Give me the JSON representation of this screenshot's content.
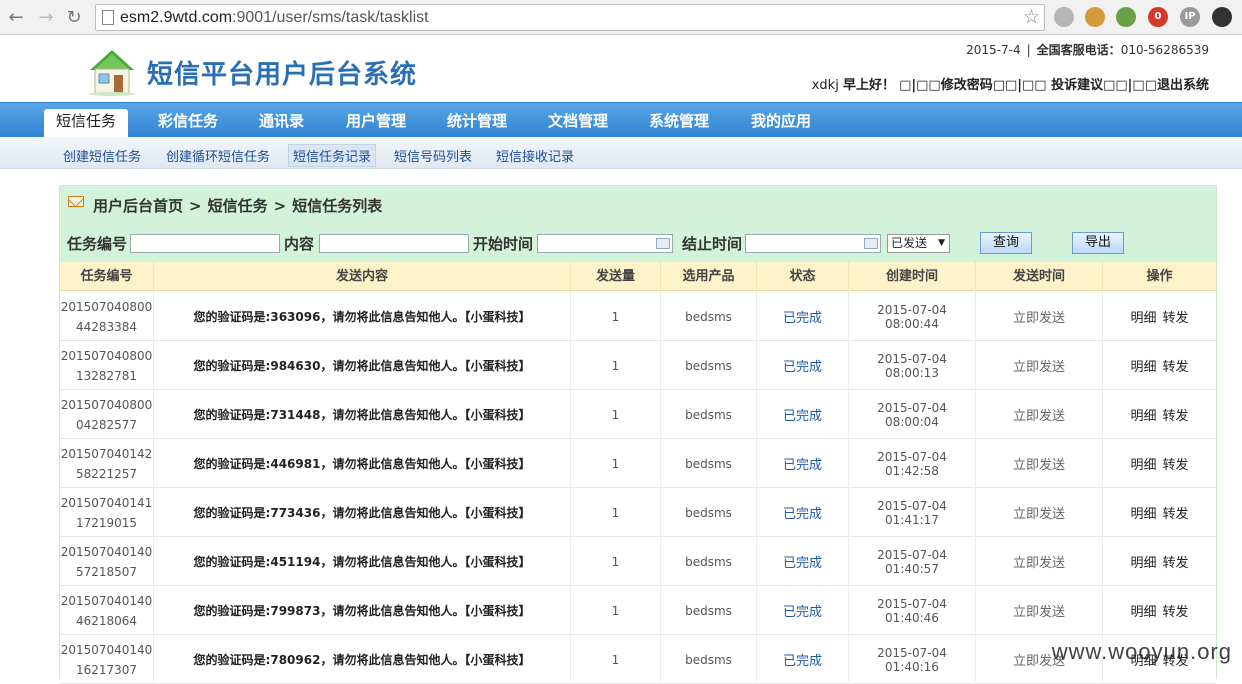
{
  "browser": {
    "url_host": "esm2.9wtd.com",
    "url_rest": ":9001/user/sms/task/tasklist",
    "extensions": [
      {
        "name": "circle-ext-icon",
        "color": "#b5b5b5",
        "text": ""
      },
      {
        "name": "cookie-ext-icon",
        "color": "#d49a3a",
        "text": ""
      },
      {
        "name": "ext3-icon",
        "color": "#6aa04a",
        "text": ""
      },
      {
        "name": "ext4-icon",
        "color": "#d23a2a",
        "text": "0"
      },
      {
        "name": "ip-ext-icon",
        "color": "#9a9a9a",
        "text": "IP"
      },
      {
        "name": "spider-ext-icon",
        "color": "#333333",
        "text": ""
      }
    ]
  },
  "header": {
    "site_title": "短信平台用户后台系统",
    "date": "2015-7-4",
    "hotline_label": "全国客服电话：",
    "hotline_number": "010-56286539",
    "username": "xdkj",
    "greeting": "早上好！",
    "links_text": "□|□□修改密码□□|□□ 投诉建议□□|□□退出系统"
  },
  "mainnav": [
    {
      "label": "短信任务",
      "active": true
    },
    {
      "label": "彩信任务"
    },
    {
      "label": "通讯录"
    },
    {
      "label": "用户管理"
    },
    {
      "label": "统计管理"
    },
    {
      "label": "文档管理"
    },
    {
      "label": "系统管理"
    },
    {
      "label": "我的应用"
    }
  ],
  "subnav": [
    {
      "label": "创建短信任务"
    },
    {
      "label": "创建循环短信任务"
    },
    {
      "label": "短信任务记录",
      "active": true
    },
    {
      "label": "短信号码列表"
    },
    {
      "label": "短信接收记录"
    }
  ],
  "breadcrumb": {
    "home": "用户后台首页",
    "section": "短信任务",
    "page": "短信任务列表",
    "separator": ">"
  },
  "filters": {
    "task_id_label": "任务编号",
    "content_label": "内容",
    "start_label": "开始时间",
    "end_label": "结止时间",
    "status_selected": "已发送",
    "query_button": "查询",
    "export_button": "导出"
  },
  "table": {
    "columns": [
      "任务编号",
      "发送内容",
      "发送量",
      "选用产品",
      "状态",
      "创建时间",
      "发送时间",
      "操作"
    ],
    "rows": [
      {
        "id1": "201507040800",
        "id2": "44283384",
        "content": "您的验证码是:363096，请勿将此信息告知他人。【小蛋科技】",
        "count": "1",
        "product": "bedsms",
        "status": "已完成",
        "created": "2015-07-04 08:00:44",
        "send": "立即发送",
        "op1": "明细",
        "op2": "转发"
      },
      {
        "id1": "201507040800",
        "id2": "13282781",
        "content": "您的验证码是:984630，请勿将此信息告知他人。【小蛋科技】",
        "count": "1",
        "product": "bedsms",
        "status": "已完成",
        "created": "2015-07-04 08:00:13",
        "send": "立即发送",
        "op1": "明细",
        "op2": "转发"
      },
      {
        "id1": "201507040800",
        "id2": "04282577",
        "content": "您的验证码是:731448，请勿将此信息告知他人。【小蛋科技】",
        "count": "1",
        "product": "bedsms",
        "status": "已完成",
        "created": "2015-07-04 08:00:04",
        "send": "立即发送",
        "op1": "明细",
        "op2": "转发"
      },
      {
        "id1": "201507040142",
        "id2": "58221257",
        "content": "您的验证码是:446981，请勿将此信息告知他人。【小蛋科技】",
        "count": "1",
        "product": "bedsms",
        "status": "已完成",
        "created": "2015-07-04 01:42:58",
        "send": "立即发送",
        "op1": "明细",
        "op2": "转发"
      },
      {
        "id1": "201507040141",
        "id2": "17219015",
        "content": "您的验证码是:773436，请勿将此信息告知他人。【小蛋科技】",
        "count": "1",
        "product": "bedsms",
        "status": "已完成",
        "created": "2015-07-04 01:41:17",
        "send": "立即发送",
        "op1": "明细",
        "op2": "转发"
      },
      {
        "id1": "201507040140",
        "id2": "57218507",
        "content": "您的验证码是:451194，请勿将此信息告知他人。【小蛋科技】",
        "count": "1",
        "product": "bedsms",
        "status": "已完成",
        "created": "2015-07-04 01:40:57",
        "send": "立即发送",
        "op1": "明细",
        "op2": "转发"
      },
      {
        "id1": "201507040140",
        "id2": "46218064",
        "content": "您的验证码是:799873，请勿将此信息告知他人。【小蛋科技】",
        "count": "1",
        "product": "bedsms",
        "status": "已完成",
        "created": "2015-07-04 01:40:46",
        "send": "立即发送",
        "op1": "明细",
        "op2": "转发"
      },
      {
        "id1": "201507040140",
        "id2": "16217307",
        "content": "您的验证码是:780962，请勿将此信息告知他人。【小蛋科技】",
        "count": "1",
        "product": "bedsms",
        "status": "已完成",
        "created": "2015-07-04 01:40:16",
        "send": "立即发送",
        "op1": "明细",
        "op2": "转发"
      }
    ]
  },
  "watermark": "www.wooyun.org"
}
